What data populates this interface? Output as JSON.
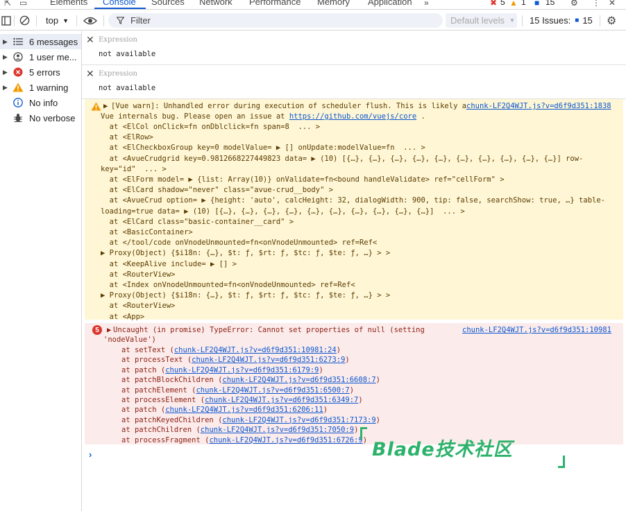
{
  "tabs": [
    {
      "label": "Elements"
    },
    {
      "label": "Console"
    },
    {
      "label": "Sources"
    },
    {
      "label": "Network"
    },
    {
      "label": "Performance"
    },
    {
      "label": "Memory"
    },
    {
      "label": "Application"
    }
  ],
  "tab_counts": {
    "errors": "5",
    "warnings": "1",
    "messages": "15"
  },
  "toolbar": {
    "context": "top",
    "filter_placeholder": "Filter",
    "levels": "Default levels",
    "issues_label": "15 Issues:",
    "issues_count": "15"
  },
  "sidebar": {
    "items": [
      {
        "label": "6 messages",
        "icon": "list-icon"
      },
      {
        "label": "1 user me...",
        "icon": "user-icon"
      },
      {
        "label": "5 errors",
        "icon": "error-icon"
      },
      {
        "label": "1 warning",
        "icon": "warning-icon"
      },
      {
        "label": "No info",
        "icon": "info-icon"
      },
      {
        "label": "No verbose",
        "icon": "bug-icon"
      }
    ]
  },
  "expressions": [
    {
      "label": "Expression",
      "value": "not available"
    },
    {
      "label": "Expression",
      "value": "not available"
    }
  ],
  "warning": {
    "source": "chunk-LF2Q4WJT.js?v=d6f9d351:1838",
    "line1": "[Vue warn]: Unhandled error during execution of scheduler flush. This is likely a",
    "line2_prefix": "Vue internals bug. Please open an issue at ",
    "line2_link": "https://github.com/vuejs/core",
    "line2_suffix": " .",
    "stack": [
      "  at <ElCol onClick=fn onDblclick=fn span=8  ... >",
      "  at <ElRow>",
      "  at <ElCheckboxGroup key=0 modelValue= ▶ [] onUpdate:modelValue=fn  ... >",
      "  at <AvueCrudgrid key=0.9812668227449823 data= ▶ (10) [{…}, {…}, {…}, {…}, {…}, {…}, {…}, {…}, {…}, {…}] row-",
      "key=\"id\"  ... >",
      "  at <ElForm model= ▶ {list: Array(10)} onValidate=fn<bound handleValidate> ref=\"cellForm\" >",
      "  at <ElCard shadow=\"never\" class=\"avue-crud__body\" >",
      "  at <AvueCrud option= ▶ {height: 'auto', calcHeight: 32, dialogWidth: 900, tip: false, searchShow: true, …} table-",
      "loading=true data= ▶ (10) [{…}, {…}, {…}, {…}, {…}, {…}, {…}, {…}, {…}, {…}]  ... >",
      "  at <ElCard class=\"basic-container__card\" >",
      "  at <BasicContainer>",
      "  at </tool/code onVnodeUnmounted=fn<onVnodeUnmounted> ref=Ref<",
      "▶ Proxy(Object) {$i18n: {…}, $t: ƒ, $rt: ƒ, $tc: ƒ, $te: ƒ, …} > >",
      "  at <KeepAlive include= ▶ [] >",
      "  at <RouterView>",
      "  at <Index onVnodeUnmounted=fn<onVnodeUnmounted> ref=Ref<",
      "▶ Proxy(Object) {$i18n: {…}, $t: ƒ, $rt: ƒ, $tc: ƒ, $te: ƒ, …} > >",
      "  at <RouterView>",
      "  at <App>"
    ]
  },
  "error": {
    "count": "5",
    "source": "chunk-LF2Q4WJT.js?v=d6f9d351:10981",
    "line1": "Uncaught (in promise) TypeError: Cannot set properties of null (setting",
    "line2": "'nodeValue')",
    "stack": [
      {
        "fn": "at setText (",
        "link": "chunk-LF2Q4WJT.js?v=d6f9d351:10981:24",
        "end": ")"
      },
      {
        "fn": "at processText (",
        "link": "chunk-LF2Q4WJT.js?v=d6f9d351:6273:9",
        "end": ")"
      },
      {
        "fn": "at patch (",
        "link": "chunk-LF2Q4WJT.js?v=d6f9d351:6179:9",
        "end": ")"
      },
      {
        "fn": "at patchBlockChildren (",
        "link": "chunk-LF2Q4WJT.js?v=d6f9d351:6608:7",
        "end": ")"
      },
      {
        "fn": "at patchElement (",
        "link": "chunk-LF2Q4WJT.js?v=d6f9d351:6500:7",
        "end": ")"
      },
      {
        "fn": "at processElement (",
        "link": "chunk-LF2Q4WJT.js?v=d6f9d351:6349:7",
        "end": ")"
      },
      {
        "fn": "at patch (",
        "link": "chunk-LF2Q4WJT.js?v=d6f9d351:6206:11",
        "end": ")"
      },
      {
        "fn": "at patchKeyedChildren (",
        "link": "chunk-LF2Q4WJT.js?v=d6f9d351:7173:9",
        "end": ")"
      },
      {
        "fn": "at patchChildren (",
        "link": "chunk-LF2Q4WJT.js?v=d6f9d351:7050:9",
        "end": ")"
      },
      {
        "fn": "at processFragment (",
        "link": "chunk-LF2Q4WJT.js?v=d6f9d351:6726:9",
        "end": ")"
      }
    ]
  },
  "prompt": "›",
  "watermark": "Blade技术社区",
  "colors": {
    "accent": "#0b57d0",
    "error": "#dc362e",
    "warning": "#f29900",
    "watermark": "#2db26b"
  }
}
